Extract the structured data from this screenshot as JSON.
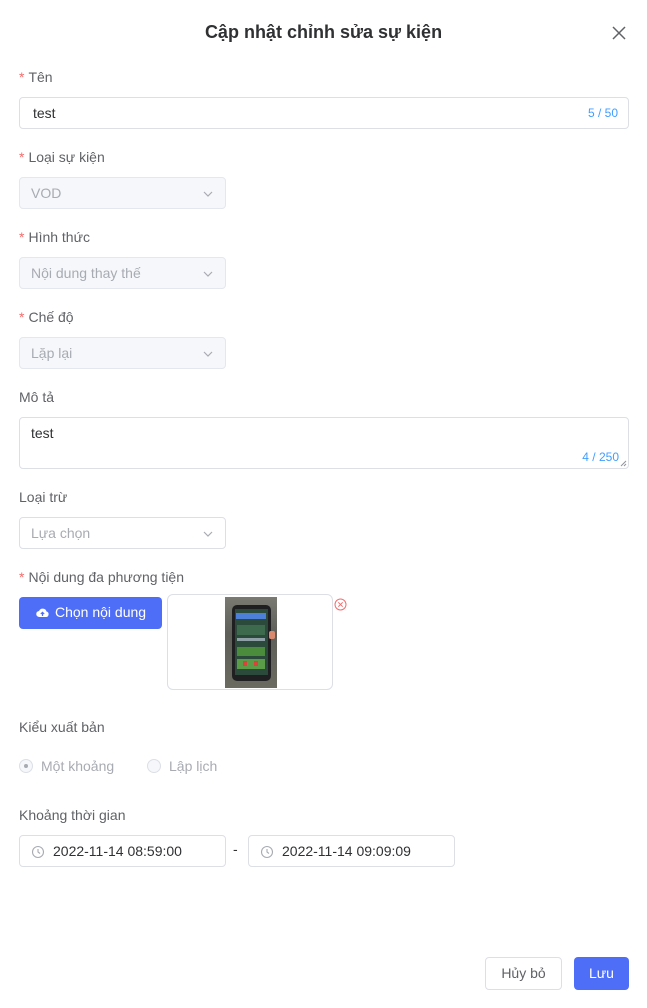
{
  "dialog": {
    "title": "Cập nhật chỉnh sửa sự kiện"
  },
  "name": {
    "label": "Tên",
    "value": "test",
    "count": "5 / 50"
  },
  "event_type": {
    "label": "Loại sự kiện",
    "value": "VOD"
  },
  "form_type": {
    "label": "Hình thức",
    "value": "Nội dung thay thế"
  },
  "mode": {
    "label": "Chế độ",
    "value": "Lặp lại"
  },
  "description": {
    "label": "Mô tả",
    "value": "test",
    "count": "4 / 250"
  },
  "exclude": {
    "label": "Loại trừ",
    "placeholder": "Lựa chọn"
  },
  "media": {
    "label": "Nội dung đa phương tiện",
    "button": "Chọn nội dung"
  },
  "publish": {
    "label": "Kiểu xuất bản",
    "options": [
      "Một khoảng",
      "Lập lịch"
    ],
    "selected": "Một khoảng"
  },
  "period": {
    "label": "Khoảng thời gian",
    "start": "2022-11-14 08:59:00",
    "separator": "-",
    "end": "2022-11-14 09:09:09"
  },
  "footer": {
    "cancel": "Hủy bỏ",
    "save": "Lưu"
  },
  "colors": {
    "primary": "#4f6ef7",
    "required": "#f56c6c",
    "counter": "#409eff"
  }
}
